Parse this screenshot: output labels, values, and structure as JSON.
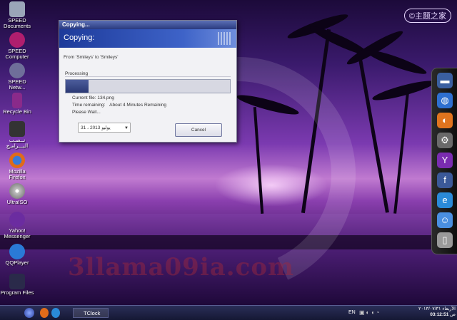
{
  "desktop": {
    "icons": [
      {
        "label": "SPEED Documents",
        "color": "#9aa6b8",
        "glyph": "folder-icon"
      },
      {
        "label": "SPEED Computer",
        "color": "#b01e6e",
        "glyph": "computer-icon"
      },
      {
        "label": "SPEED Netw...",
        "color": "#6f6f9a",
        "glyph": "network-icon"
      },
      {
        "label": "Recycle Bin",
        "color": "#8a2a8a",
        "glyph": "recycle-bin-icon"
      },
      {
        "label": "نــصـب البـــرامـج",
        "color": "#333",
        "glyph": "programs-icon"
      },
      {
        "label": "Mozilla Firefox",
        "color": "#e06b1a",
        "glyph": "firefox-icon"
      },
      {
        "label": "UltraISO",
        "color": "#c2c2c2",
        "glyph": "disc-icon"
      },
      {
        "label": "Yahoo! Messenger",
        "color": "#6b2ca0",
        "glyph": "yahoo-icon"
      },
      {
        "label": "QQPlayer",
        "color": "#2a7ad6",
        "glyph": "qqplayer-icon"
      },
      {
        "label": "Program Files",
        "color": "#2a2a4a",
        "glyph": "folder-icon"
      }
    ]
  },
  "watermark": {
    "top_right": "©主题之家",
    "bottom_text": "3llama09ia.com"
  },
  "dialog": {
    "window_title": "Copying...",
    "banner_title": "Copying:",
    "from_to": "From 'Smileys' to 'Smileys'",
    "section_label": "Processing",
    "progress_fraction": 0.14,
    "current_file": "Current file: 134.png",
    "time_label": "Time remaining:",
    "time_value": "About   4 Minutes Remaining",
    "please_wait": "Please Wait...",
    "date_value": "31   ، يوليو   2013",
    "cancel_label": "Cancel"
  },
  "dock": {
    "items": [
      {
        "name": "monitor-icon",
        "glyph": "▬",
        "color": "#3a5fa0"
      },
      {
        "name": "globe-icon",
        "glyph": "◍",
        "color": "#2e6fcf"
      },
      {
        "name": "firefox-icon",
        "glyph": "◐",
        "color": "#e0741e"
      },
      {
        "name": "gear-icon",
        "glyph": "⚙",
        "color": "#6a6a6a"
      },
      {
        "name": "yahoo-icon",
        "glyph": "Y",
        "color": "#7a2cb0"
      },
      {
        "name": "facebook-icon",
        "glyph": "f",
        "color": "#3b5998"
      },
      {
        "name": "ie-icon",
        "glyph": "e",
        "color": "#2a8ad8"
      },
      {
        "name": "finder-icon",
        "glyph": "☺",
        "color": "#4a8fe0"
      },
      {
        "name": "trash-icon",
        "glyph": "▯",
        "color": "#9a9a9a"
      }
    ]
  },
  "taskbar": {
    "task_label": "TClock",
    "language": "EN",
    "time": "03:12:51",
    "ampm": "ص",
    "date": "الأربعاء ٢٠١٣/٠٧/٣١"
  }
}
